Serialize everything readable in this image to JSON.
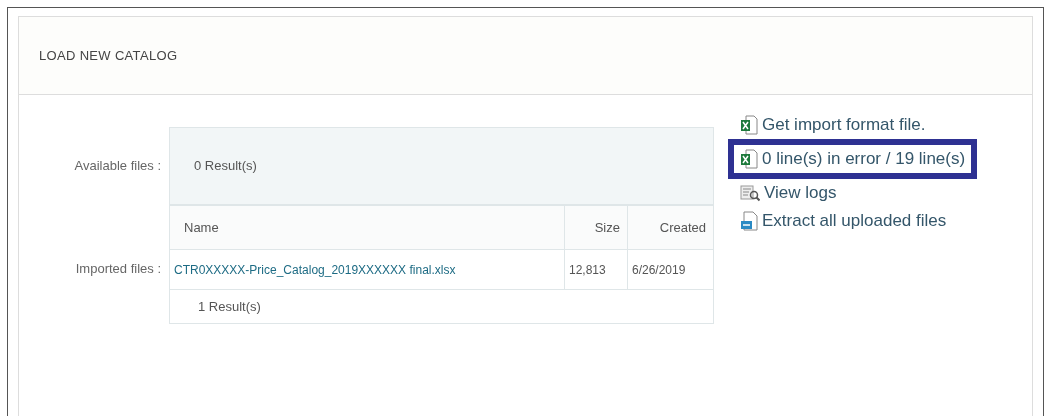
{
  "panel": {
    "title": "LOAD NEW CATALOG"
  },
  "available_files": {
    "label": "Available files :",
    "result_count": "0 Result(s)"
  },
  "imported_files": {
    "label": "Imported files :",
    "columns": [
      "Name",
      "Size",
      "Created"
    ],
    "rows": [
      {
        "name": "CTR0XXXXX-Price_Catalog_2019XXXXXX final.xlsx",
        "size": "12,813",
        "created": "6/26/2019"
      }
    ],
    "result_count": "1 Result(s)"
  },
  "links": [
    {
      "kind": "excel",
      "label": "Get import format file.",
      "highlighted": false
    },
    {
      "kind": "excel",
      "label": "0 line(s) in error / 19 line(s)",
      "highlighted": true
    },
    {
      "kind": "logs",
      "label": "View logs",
      "highlighted": false
    },
    {
      "kind": "zip",
      "label": "Extract all uploaded files",
      "highlighted": false
    }
  ]
}
